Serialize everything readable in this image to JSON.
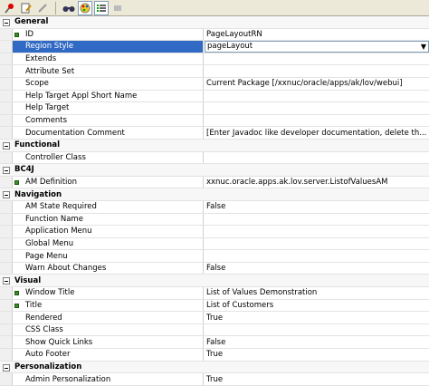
{
  "toolbar": {
    "icons": [
      "pin-icon",
      "edit-icon",
      "pencil-icon",
      "find-icon",
      "palette-icon",
      "list-icon",
      "tag-icon"
    ]
  },
  "colors": {
    "selection": "#316ac5",
    "marker": "#3a8e2a"
  },
  "categories": [
    {
      "name": "General",
      "rows": [
        {
          "label": "ID",
          "value": "PageLayoutRN",
          "marker": true
        },
        {
          "label": "Region Style",
          "value": "pageLayout",
          "marker": true,
          "selected": true,
          "dropdown": true
        },
        {
          "label": "Extends",
          "value": ""
        },
        {
          "label": "Attribute Set",
          "value": ""
        },
        {
          "label": "Scope",
          "value": "Current Package [/xxnuc/oracle/apps/ak/lov/webui]"
        },
        {
          "label": "Help Target Appl Short Name",
          "value": ""
        },
        {
          "label": "Help Target",
          "value": ""
        },
        {
          "label": "Comments",
          "value": ""
        },
        {
          "label": "Documentation Comment",
          "value": "[Enter Javadoc like developer documentation, delete th..."
        }
      ]
    },
    {
      "name": "Functional",
      "rows": [
        {
          "label": "Controller Class",
          "value": ""
        }
      ]
    },
    {
      "name": "BC4J",
      "rows": [
        {
          "label": "AM Definition",
          "value": "xxnuc.oracle.apps.ak.lov.server.ListofValuesAM",
          "marker": true
        }
      ]
    },
    {
      "name": "Navigation",
      "rows": [
        {
          "label": "AM State Required",
          "value": "False"
        },
        {
          "label": "Function Name",
          "value": ""
        },
        {
          "label": "Application Menu",
          "value": ""
        },
        {
          "label": "Global Menu",
          "value": ""
        },
        {
          "label": "Page Menu",
          "value": ""
        },
        {
          "label": "Warn About Changes",
          "value": "False"
        }
      ]
    },
    {
      "name": "Visual",
      "rows": [
        {
          "label": "Window Title",
          "value": "List of Values Demonstration",
          "marker": true
        },
        {
          "label": "Title",
          "value": "List of Customers",
          "marker": true
        },
        {
          "label": "Rendered",
          "value": "True"
        },
        {
          "label": "CSS Class",
          "value": ""
        },
        {
          "label": "Show Quick Links",
          "value": "False"
        },
        {
          "label": "Auto Footer",
          "value": "True"
        }
      ]
    },
    {
      "name": "Personalization",
      "rows": [
        {
          "label": "Admin Personalization",
          "value": "True"
        }
      ]
    }
  ]
}
